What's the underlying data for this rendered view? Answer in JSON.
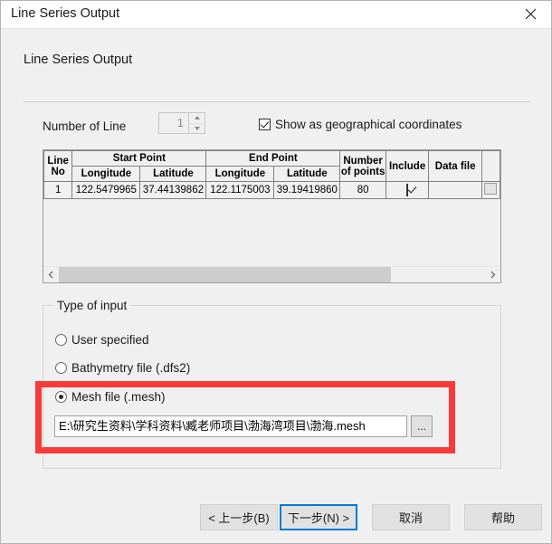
{
  "window": {
    "title": "Line Series Output",
    "close_icon": "close-icon"
  },
  "page": {
    "heading": "Line Series Output"
  },
  "controls": {
    "number_of_line_label": "Number of Line",
    "number_of_line_value": "1",
    "show_geo_label": "Show as geographical coordinates",
    "show_geo_checked": true
  },
  "grid": {
    "group_headers": {
      "line_no": "Line\nNo",
      "start_point": "Start Point",
      "end_point": "End Point",
      "number_of_points": "Number\nof points",
      "include": "Include",
      "data_file": "Data file"
    },
    "line_no_line1": "Line",
    "line_no_line2": "No",
    "start_point": "Start Point",
    "end_point": "End Point",
    "num_points_line1": "Number",
    "num_points_line2": "of points",
    "include": "Include",
    "data_file": "Data file",
    "sub_headers": {
      "longitude": "Longitude",
      "latitude": "Latitude"
    },
    "rows": [
      {
        "line_no": "1",
        "start_longitude": "122.5479965",
        "start_latitude": "37.44139862",
        "end_longitude": "122.1175003",
        "end_latitude": "39.19419860",
        "number_of_points": "80",
        "include": true,
        "data_file": "",
        "extra_button": "..."
      }
    ],
    "scroll_left_icon": "chevron-left-icon",
    "scroll_right_icon": "chevron-right-icon"
  },
  "type_of_input": {
    "title": "Type of input",
    "options": [
      {
        "label": "User specified",
        "selected": false
      },
      {
        "label": "Bathymetry file (.dfs2)",
        "selected": false
      },
      {
        "label": "Mesh file (.mesh)",
        "selected": true
      }
    ],
    "mesh_path_value": "E:\\研究生资料\\学科资料\\臧老师项目\\渤海湾项目\\渤海.mesh",
    "browse_label": "...",
    "highlight_color": "#f93a3a"
  },
  "footer": {
    "back": "< 上一步(B)",
    "next": "下一步(N) >",
    "cancel": "取消",
    "help": "帮助",
    "focus_color": "#0078d7"
  }
}
